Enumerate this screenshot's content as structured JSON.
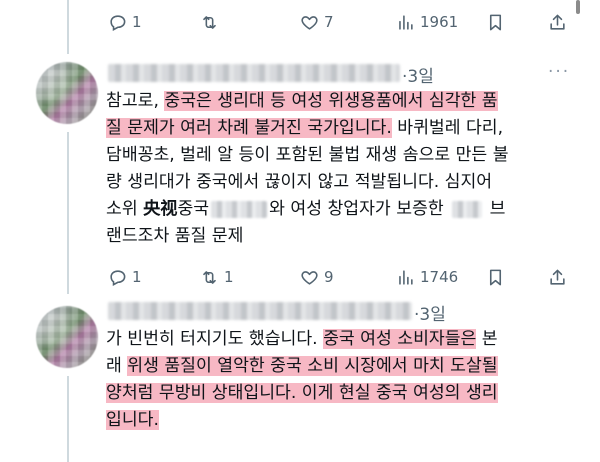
{
  "top_actions": {
    "reply": "1",
    "retweet": "",
    "like": "7",
    "views": "1961"
  },
  "tweets": [
    {
      "date": "·3일",
      "more": "···",
      "body": {
        "l1_pre": "참고로, ",
        "l1_hl": "중국은 생리대 등 여성 위생용품에서 심각한 품",
        "l2_hl": "질 문제가 여러 차례 불거진 국가입니다.",
        "l2_post": " 바퀴벌레 다리,",
        "l3": "담배꽁초, 벌레 알 등이 포함된 불법 재생 솜으로 만든 불",
        "l4": "량 생리대가 중국에서 끊이지 않고 적발됩니다. 심지어",
        "l5_a": "소위 ",
        "l5_b": "央视",
        "l5_c": "중국",
        "l5_d": "와 여성 창업자가 보증한",
        "l5_e": "브",
        "l6": "랜드조차 품질 문제"
      },
      "actions": {
        "reply": "1",
        "retweet": "1",
        "like": "9",
        "views": "1746"
      }
    },
    {
      "date": "·3일",
      "body": {
        "l1_pre": "가 빈번히 터지기도 했습니다. ",
        "l1_hl": "중국 여성 소비자들은",
        "l1_post": " 본",
        "l2_pre": "래 ",
        "l2_hl": "위생 품질이 열악한 중국 소비 시장에서 마치 도살될",
        "l3_hl": "양처럼 무방비 상태입니다. 이게 현실 중국 여성의 생리",
        "l4_hl": "입니다."
      }
    }
  ]
}
